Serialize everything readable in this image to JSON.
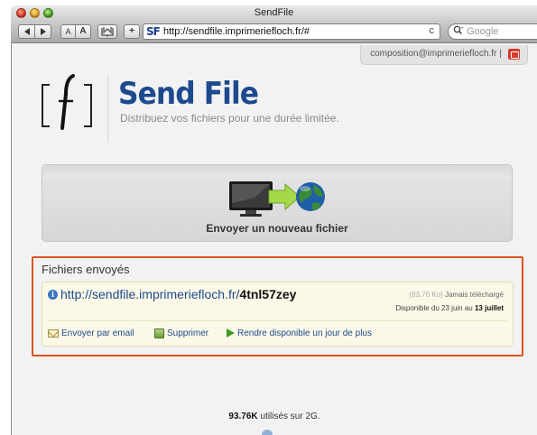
{
  "window": {
    "title": "SendFile"
  },
  "toolbar": {
    "small_text_label": "A",
    "large_text_label": "A",
    "add_label": "+",
    "favicon_label": "SF",
    "url": "http://sendfile.imprimeriefloch.fr/#",
    "reload_label": "c",
    "search_placeholder": "Google"
  },
  "account": {
    "email": "composition@imprimeriefloch.fr",
    "separator": "|"
  },
  "brand": {
    "name": "Send File",
    "tagline": "Distribuez vos fichiers pour une durée limitée."
  },
  "upload": {
    "label": "Envoyer un nouveau fichier"
  },
  "files": {
    "title": "Fichiers envoyés",
    "items": [
      {
        "url_prefix": "http://sendfile.imprimeriefloch.fr/",
        "code": "4tnl57zey",
        "size": "(93.76 Ko)",
        "download_status": "Jamais téléchargé",
        "availability_prefix": "Disponible du 23 juin au",
        "availability_end": "13 juillet",
        "actions": {
          "email": "Envoyer par email",
          "delete": "Supprimer",
          "extend": "Rendre disponible un jour de plus"
        }
      }
    ]
  },
  "quota": {
    "used": "93.76K",
    "suffix": "utilisés sur 2G."
  },
  "colors": {
    "brand_blue": "#1c4a8e",
    "highlight_border": "#d9541f",
    "card_background": "#fbf8e7"
  }
}
